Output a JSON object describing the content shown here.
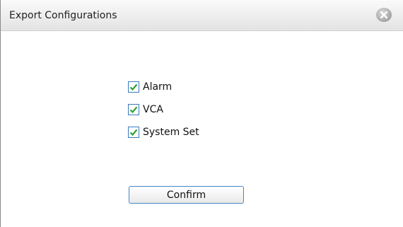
{
  "dialog": {
    "title": "Export Configurations",
    "close_icon": "close-icon"
  },
  "options": [
    {
      "label": "Alarm",
      "checked": true
    },
    {
      "label": "VCA",
      "checked": true
    },
    {
      "label": "System Set",
      "checked": true
    }
  ],
  "confirm_label": "Confirm",
  "colors": {
    "checkmark": "#2fa12f",
    "checkbox_border": "#3a7bbd",
    "button_border": "#4a86c5"
  }
}
